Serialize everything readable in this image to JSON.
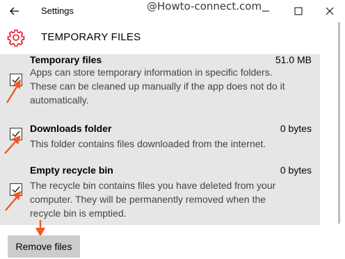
{
  "window": {
    "title": "Settings",
    "watermark": "@Howto-connect.com",
    "minimize_icon": "minimize-icon",
    "maximize_icon": "maximize-icon",
    "close_icon": "close-icon",
    "back_icon": "back-arrow-icon"
  },
  "header": {
    "icon": "gear-icon",
    "title": "TEMPORARY FILES",
    "accent_color": "#e81123"
  },
  "items": [
    {
      "title": "Temporary files",
      "size": "51.0 MB",
      "checked": true,
      "description_lines": [
        "Apps can store temporary information in specific folders.",
        "These can be cleaned up manually if the app does not do it",
        "automatically."
      ]
    },
    {
      "title": "Downloads folder",
      "size": "0 bytes",
      "checked": true,
      "description_lines": [
        "This folder contains files downloaded from the internet."
      ]
    },
    {
      "title": "Empty recycle bin",
      "size": "0 bytes",
      "checked": true,
      "description_lines": [
        "The recycle bin contains files you have deleted from your",
        "computer. They will be permanently removed when the",
        "recycle bin is emptied."
      ]
    }
  ],
  "actions": {
    "remove_label": "Remove files"
  },
  "annotation_color": "#f05a22"
}
